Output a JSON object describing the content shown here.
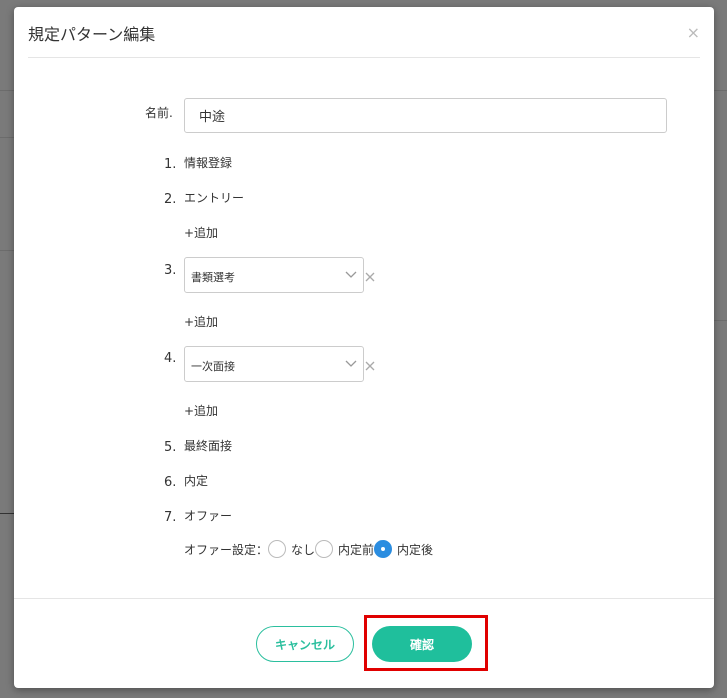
{
  "modal": {
    "title": "規定パターン編集",
    "close_icon": "×"
  },
  "name_field": {
    "label": "名前.",
    "value": "中途"
  },
  "steps": [
    {
      "num": "1.",
      "label": "情報登録"
    },
    {
      "num": "2.",
      "label": "エントリー"
    },
    {
      "num": "3.",
      "selected": "書類選考"
    },
    {
      "num": "4.",
      "selected": "一次面接"
    },
    {
      "num": "5.",
      "label": "最終面接"
    },
    {
      "num": "6.",
      "label": "内定"
    },
    {
      "num": "7.",
      "label": "オファー"
    }
  ],
  "add_label": "+追加",
  "offer_setting": {
    "label": "オファー設定：",
    "options": [
      "なし",
      "内定前",
      "内定後"
    ],
    "selected": "内定後"
  },
  "footer": {
    "cancel_label": "キャンセル",
    "confirm_label": "確認"
  },
  "colors": {
    "accent": "#1fbf9c",
    "radio_checked": "#2b8de0",
    "highlight": "#e00000"
  }
}
